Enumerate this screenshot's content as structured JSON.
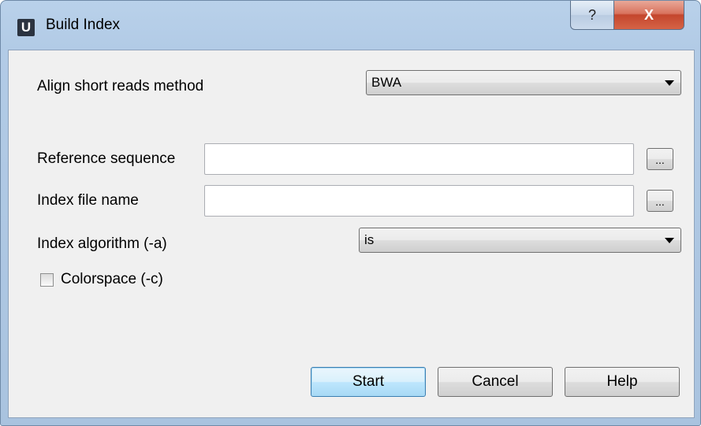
{
  "window": {
    "title": "Build Index",
    "logo_letter": "U",
    "help_glyph": "?",
    "close_glyph": "X"
  },
  "form": {
    "method_label": "Align short reads method",
    "method_value": "BWA",
    "reference_label": "Reference sequence",
    "reference_value": "",
    "index_file_label": "Index file name",
    "index_file_value": "",
    "browse_label": "...",
    "algorithm_label": "Index algorithm (-a)",
    "algorithm_value": "is",
    "colorspace_label": "Colorspace (-c)",
    "colorspace_checked": false
  },
  "buttons": {
    "start": "Start",
    "cancel": "Cancel",
    "help": "Help"
  },
  "icons": {
    "logo": "ugene-logo-icon",
    "help": "question-mark-icon",
    "close": "close-icon",
    "dropdown": "chevron-down-icon"
  }
}
